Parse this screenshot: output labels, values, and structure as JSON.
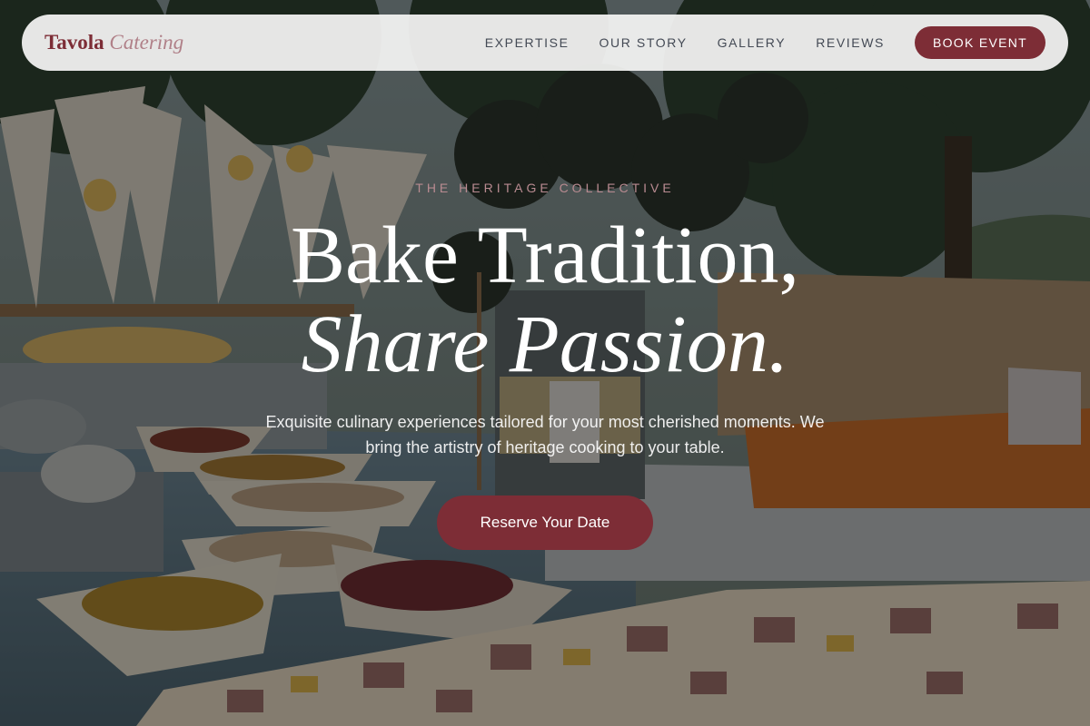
{
  "brand": {
    "name": "Tavola",
    "suffix": "Catering"
  },
  "nav": {
    "items": [
      {
        "label": "EXPERTISE"
      },
      {
        "label": "OUR STORY"
      },
      {
        "label": "GALLERY"
      },
      {
        "label": "REVIEWS"
      }
    ],
    "cta_label": "BOOK EVENT"
  },
  "hero": {
    "eyebrow": "THE HERITAGE COLLECTIVE",
    "headline_line1": "Bake Tradition,",
    "headline_line2": "Share Passion.",
    "subtext": "Exquisite culinary experiences tailored for your most cherished moments. We bring the artistry of heritage cooking to your table.",
    "cta_label": "Reserve Your Date",
    "image_alt": "Outdoor catering table with paper cones of chips, bowls of nuts and salami, and trays of sandwiches"
  },
  "colors": {
    "accent": "#7d2d36",
    "nav_background": "#f5f5f4",
    "nav_text": "#444a55",
    "eyebrow": "#b98b91",
    "headline": "#ffffff"
  }
}
